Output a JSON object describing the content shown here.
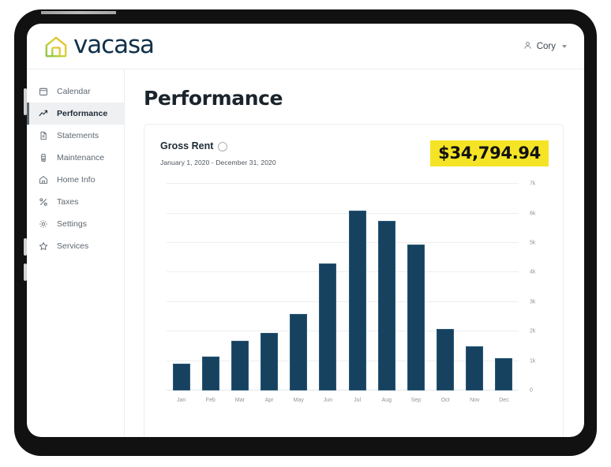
{
  "brand": {
    "name": "vacasa",
    "logo_icon": "house-icon",
    "wordmark_color": "#11304a",
    "accent_yellow": "#f5e425",
    "bar_color": "#164260"
  },
  "topbar": {
    "account_icon": "person-icon",
    "account_name": "Cory",
    "dropdown_icon": "chevron-down-icon"
  },
  "sidebar": {
    "items": [
      {
        "label": "Calendar",
        "icon": "calendar-icon",
        "active": false
      },
      {
        "label": "Performance",
        "icon": "trending-up-icon",
        "active": true
      },
      {
        "label": "Statements",
        "icon": "document-icon",
        "active": false
      },
      {
        "label": "Maintenance",
        "icon": "wrench-icon",
        "active": false
      },
      {
        "label": "Home Info",
        "icon": "home-icon",
        "active": false
      },
      {
        "label": "Taxes",
        "icon": "percent-icon",
        "active": false
      },
      {
        "label": "Settings",
        "icon": "gear-icon",
        "active": false
      },
      {
        "label": "Services",
        "icon": "star-icon",
        "active": false
      }
    ]
  },
  "main": {
    "page_title": "Performance",
    "card": {
      "metric_label": "Gross Rent",
      "info_icon": "info-circle-icon",
      "date_range": "January 1, 2020 - December 31, 2020",
      "amount": "$34,794.94"
    }
  },
  "chart_data": {
    "type": "bar",
    "title": "Gross Rent",
    "subtitle": "January 1, 2020 - December 31, 2020",
    "xlabel": "",
    "ylabel": "",
    "categories": [
      "Jan",
      "Feb",
      "Mar",
      "Apr",
      "May",
      "Jun",
      "Jul",
      "Aug",
      "Sep",
      "Oct",
      "Nov",
      "Dec"
    ],
    "values": [
      900,
      1150,
      1700,
      1950,
      2600,
      4300,
      6100,
      5750,
      4950,
      2100,
      1500,
      1100
    ],
    "ylim": [
      0,
      7000
    ],
    "yticks": [
      0,
      1000,
      2000,
      3000,
      4000,
      5000,
      6000,
      7000
    ],
    "ytick_labels": [
      "0",
      "1k",
      "2k",
      "3k",
      "4k",
      "5k",
      "6k",
      "7k"
    ],
    "grid": true,
    "legend": false,
    "series_color": "#164260",
    "total": "$34,794.94"
  }
}
